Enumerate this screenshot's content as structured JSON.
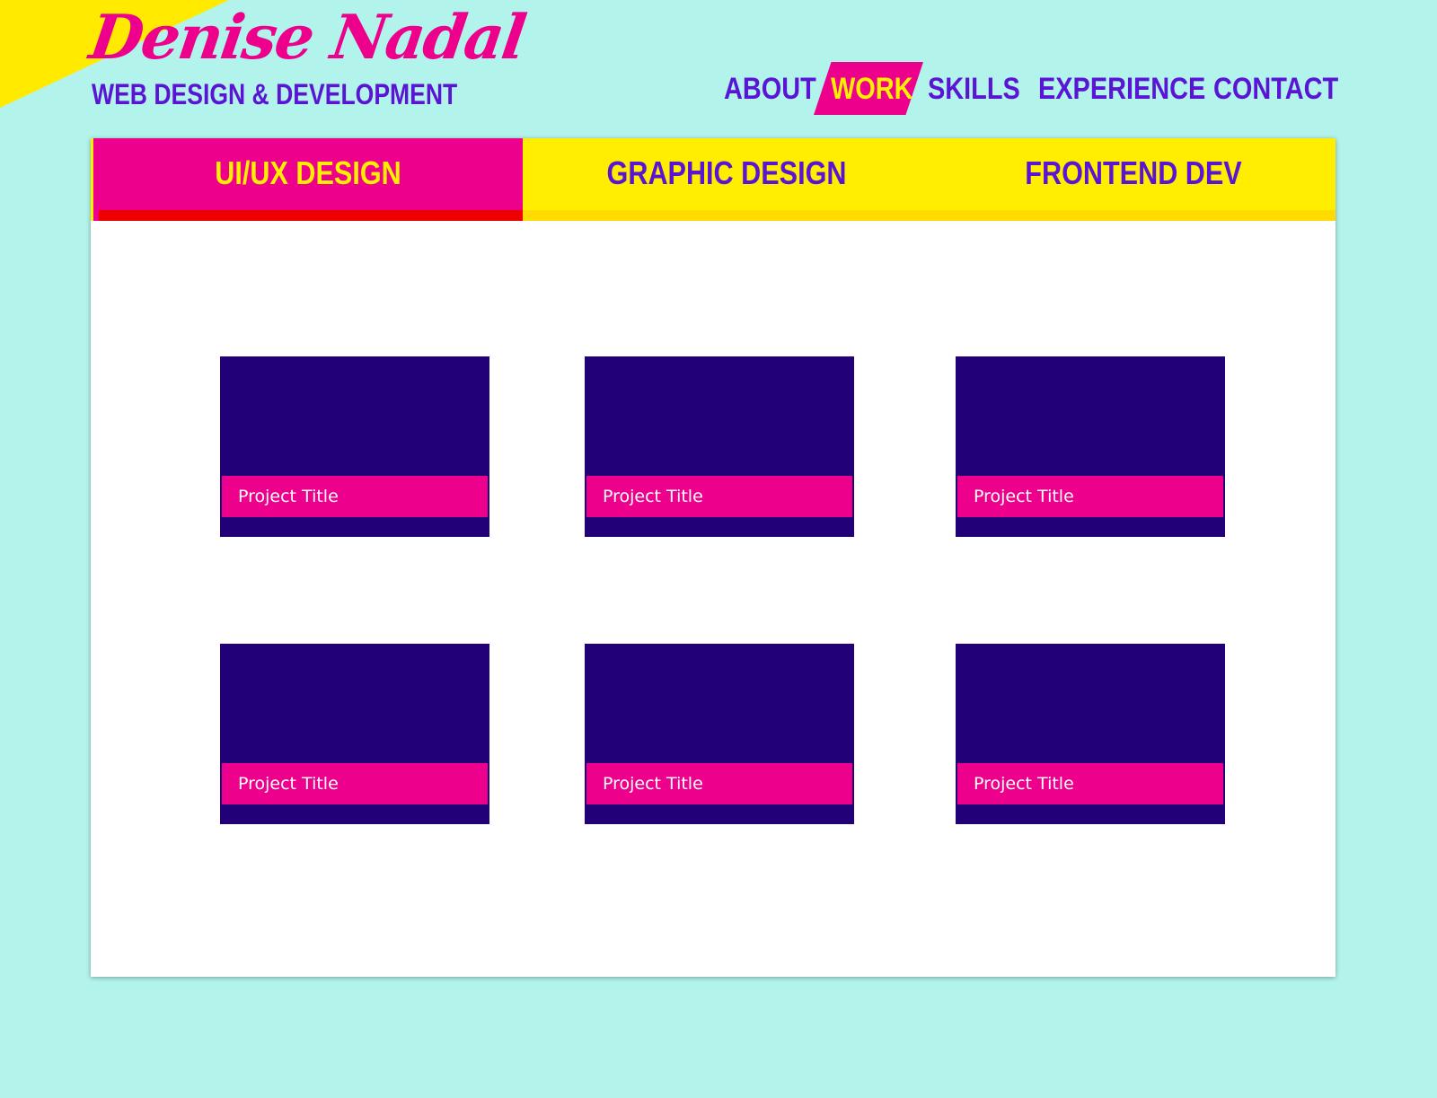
{
  "header": {
    "name": "Denise Nadal",
    "tagline": "WEB DESIGN & DEVELOPMENT"
  },
  "nav": {
    "items": [
      {
        "label": "ABOUT",
        "active": false
      },
      {
        "label": "WORK",
        "active": true
      },
      {
        "label": "SKILLS",
        "active": false
      },
      {
        "label": "EXPERIENCE",
        "active": false
      },
      {
        "label": "CONTACT",
        "active": false
      }
    ]
  },
  "work": {
    "tabs": [
      {
        "label": "UI/UX DESIGN",
        "active": true
      },
      {
        "label": "GRAPHIC DESIGN",
        "active": false
      },
      {
        "label": "FRONTEND DEV",
        "active": false
      }
    ],
    "projects": [
      {
        "title": "Project Title"
      },
      {
        "title": "Project Title"
      },
      {
        "title": "Project Title"
      },
      {
        "title": "Project Title"
      },
      {
        "title": "Project Title"
      },
      {
        "title": "Project Title"
      }
    ]
  },
  "colors": {
    "background": "#b2f4ec",
    "accent_pink": "#ec008c",
    "accent_yellow": "#ffee00",
    "purple_text": "#5a14d4",
    "card_navy": "#220077",
    "active_underline": "#ee0000"
  }
}
